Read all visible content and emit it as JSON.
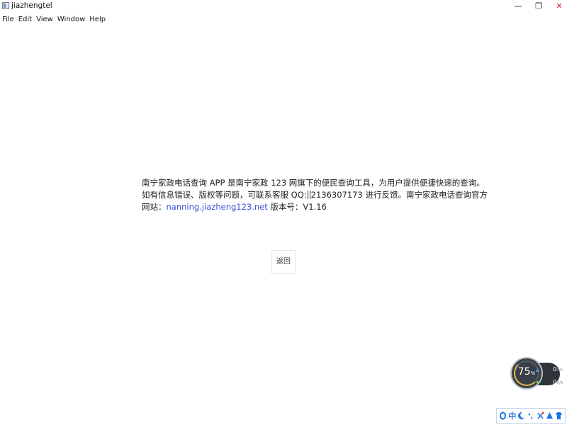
{
  "window": {
    "title": "jiazhengtel",
    "minimize_glyph": "—",
    "restore_glyph": "❐",
    "close_glyph": "✕"
  },
  "menu": {
    "items": [
      "File",
      "Edit",
      "View",
      "Window",
      "Help"
    ]
  },
  "about": {
    "line1": "南宁家政电话查询 APP 是南宁家政 123 网旗下的便民查询工具，为用户提供便捷快速的查询。",
    "line2_a": "如有信息错误、版权等问题，可联系客服 QQ:",
    "line2_b": "2136307173 进行反馈。南宁家政电话查询官方",
    "line3_prefix": "网站：",
    "link_text": "nanning.jiazheng123.net",
    "line3_suffix": " 版本号：V1.16"
  },
  "back_button": {
    "label": "返回"
  },
  "speed_widget": {
    "percent": "75",
    "percent_unit": "%",
    "upload_value": "0",
    "download_value": "0",
    "rate_unit": "K/s"
  },
  "ime": {
    "mode_label": "中",
    "icons": [
      "logo-icon",
      "mode-label",
      "moon-icon",
      "punctuation-icon",
      "tools-icon",
      "skin-icon",
      "shirt-icon"
    ]
  },
  "colors": {
    "link": "#3a50d9",
    "close_red": "#e81123",
    "widget_bg": "#2f343b",
    "ime_blue": "#1a73e8"
  }
}
